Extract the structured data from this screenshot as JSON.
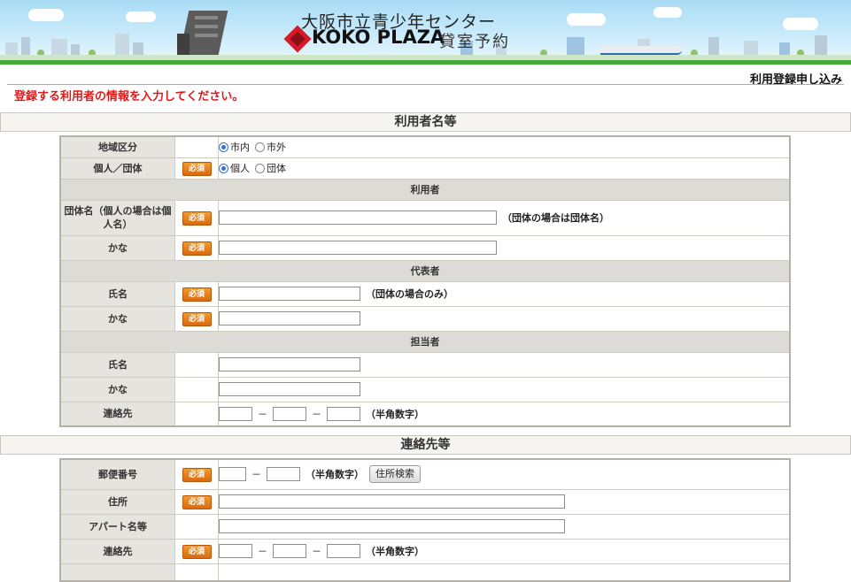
{
  "header": {
    "title": "大阪市立青少年センター",
    "brand": "KOKO PLAZA",
    "subtitle": "貸室予約"
  },
  "page_label": "利用登録申し込み",
  "notice": "登録する利用者の情報を入力してください。",
  "required_label": "必須",
  "sections": {
    "user": "利用者名等",
    "contact": "連絡先等"
  },
  "fields": {
    "area": {
      "label": "地域区分",
      "options": [
        "市内",
        "市外"
      ],
      "selected": "市内"
    },
    "type": {
      "label": "個人／団体",
      "options": [
        "個人",
        "団体"
      ],
      "selected": "個人"
    },
    "user_header": "利用者",
    "group_name": {
      "label": "団体名（個人の場合は個人名）",
      "note": "（団体の場合は団体名）",
      "value": ""
    },
    "group_kana": {
      "label": "かな",
      "value": ""
    },
    "rep_header": "代表者",
    "rep_name": {
      "label": "氏名",
      "note": "（団体の場合のみ）",
      "value": ""
    },
    "rep_kana": {
      "label": "かな",
      "value": ""
    },
    "staff_header": "担当者",
    "staff_name": {
      "label": "氏名",
      "value": ""
    },
    "staff_kana": {
      "label": "かな",
      "value": ""
    },
    "staff_phone": {
      "label": "連絡先",
      "note": "（半角数字）",
      "dash": "－"
    },
    "postal": {
      "label": "郵便番号",
      "note": "（半角数字）",
      "dash": "－",
      "button": "住所検索"
    },
    "address": {
      "label": "住所",
      "value": ""
    },
    "apartment": {
      "label": "アパート名等",
      "value": ""
    },
    "phone": {
      "label": "連絡先",
      "note": "（半角数字）",
      "dash": "－"
    }
  },
  "colors": {
    "green_bar": "#45a83b",
    "notice_red": "#e0191a",
    "badge_orange": "#e8801e",
    "label_bg": "#e6e4df",
    "orange_line": "#e8a238"
  }
}
